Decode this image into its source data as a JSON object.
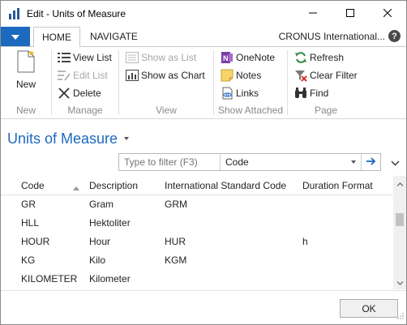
{
  "window": {
    "title": "Edit - Units of Measure"
  },
  "tabs": {
    "home": "HOME",
    "navigate": "NAVIGATE"
  },
  "company": "CRONUS International...",
  "help": "?",
  "ribbon": {
    "new": {
      "new_label": "New",
      "group": "New"
    },
    "manage": {
      "view_list": "View List",
      "edit_list": "Edit List",
      "delete": "Delete",
      "group": "Manage"
    },
    "view": {
      "show_as_list": "Show as List",
      "show_as_chart": "Show as Chart",
      "group": "View"
    },
    "show_attached": {
      "onenote": "OneNote",
      "notes": "Notes",
      "links": "Links",
      "group": "Show Attached"
    },
    "page": {
      "refresh": "Refresh",
      "clear_filter": "Clear Filter",
      "find": "Find",
      "group": "Page"
    }
  },
  "page_title": "Units of Measure",
  "filter": {
    "placeholder": "Type to filter (F3)",
    "field": "Code"
  },
  "grid": {
    "headers": [
      "Code",
      "Description",
      "International Standard Code",
      "Duration Format"
    ],
    "rows": [
      [
        "GR",
        "Gram",
        "GRM",
        ""
      ],
      [
        "HLL",
        "Hektoliter",
        "",
        ""
      ],
      [
        "HOUR",
        "Hour",
        "HUR",
        "h"
      ],
      [
        "KG",
        "Kilo",
        "KGM",
        ""
      ],
      [
        "KILOMETER",
        "Kilometer",
        "",
        ""
      ]
    ]
  },
  "footer": {
    "ok_label": "OK"
  },
  "colors": {
    "accent": "#1c6ac0",
    "disabled": "#a6a6a6"
  },
  "icons": [
    "app-icon",
    "minimize-icon",
    "maximize-icon",
    "close-icon",
    "menu-caret-icon",
    "help-icon",
    "new-document-icon",
    "view-list-icon",
    "edit-list-icon",
    "delete-icon",
    "show-as-list-icon",
    "show-as-chart-icon",
    "onenote-icon",
    "notes-icon",
    "links-icon",
    "refresh-icon",
    "clear-filter-icon",
    "find-icon",
    "arrow-right-icon",
    "chevron-down-icon",
    "sort-up-icon",
    "scroll-up-icon",
    "scroll-down-icon",
    "resize-grip-icon"
  ]
}
